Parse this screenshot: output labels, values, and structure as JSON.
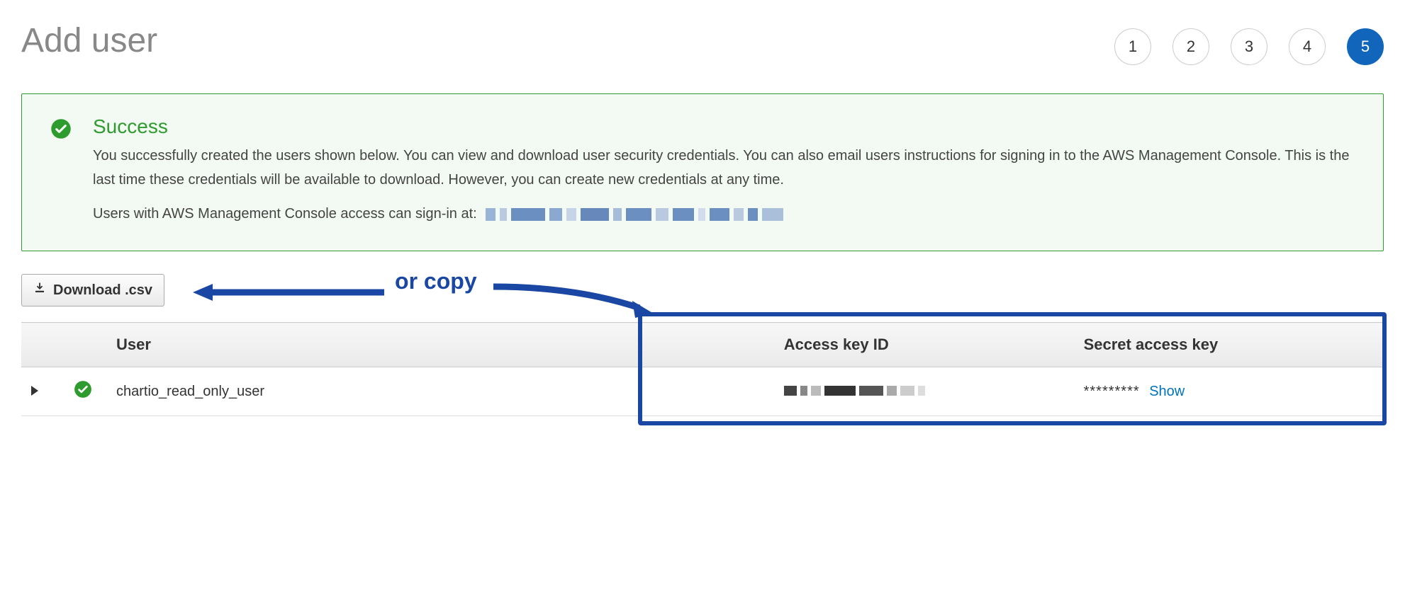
{
  "page": {
    "title": "Add user"
  },
  "steps": {
    "items": [
      "1",
      "2",
      "3",
      "4",
      "5"
    ],
    "active": 5
  },
  "alert": {
    "title": "Success",
    "message": "You successfully created the users shown below. You can view and download user security credentials. You can also email users instructions for signing in to the AWS Management Console. This is the last time these credentials will be available to download. However, you can create new credentials at any time.",
    "signin_prefix": "Users with AWS Management Console access can sign-in at:"
  },
  "download": {
    "label": "Download .csv"
  },
  "annotation": {
    "text": "or copy"
  },
  "table": {
    "headers": {
      "user": "User",
      "access_key": "Access key ID",
      "secret_key": "Secret access key"
    },
    "rows": [
      {
        "user": "chartio_read_only_user",
        "secret_mask": "*********",
        "show_label": "Show"
      }
    ]
  }
}
